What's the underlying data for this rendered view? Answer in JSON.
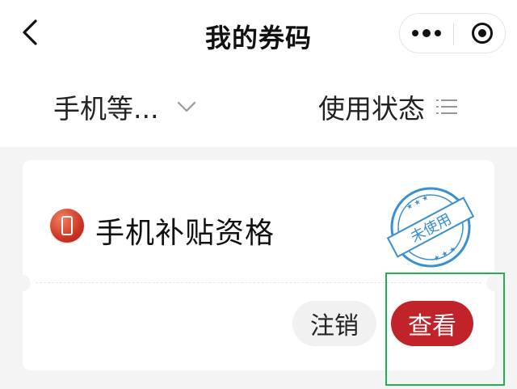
{
  "header": {
    "title": "我的券码",
    "back_icon": "chevron-left-icon",
    "more_icon": "more-dots-icon",
    "close_icon": "close-target-icon"
  },
  "filters": {
    "category_label": "手机等...",
    "status_label": "使用状态"
  },
  "coupon": {
    "title": "手机补贴资格",
    "stamp_text": "未使用",
    "icon": "phone-icon",
    "cancel_label": "注销",
    "view_label": "查看"
  },
  "colors": {
    "accent": "#c0242a",
    "stamp": "#3a8fd0",
    "highlight": "#22b14c"
  }
}
